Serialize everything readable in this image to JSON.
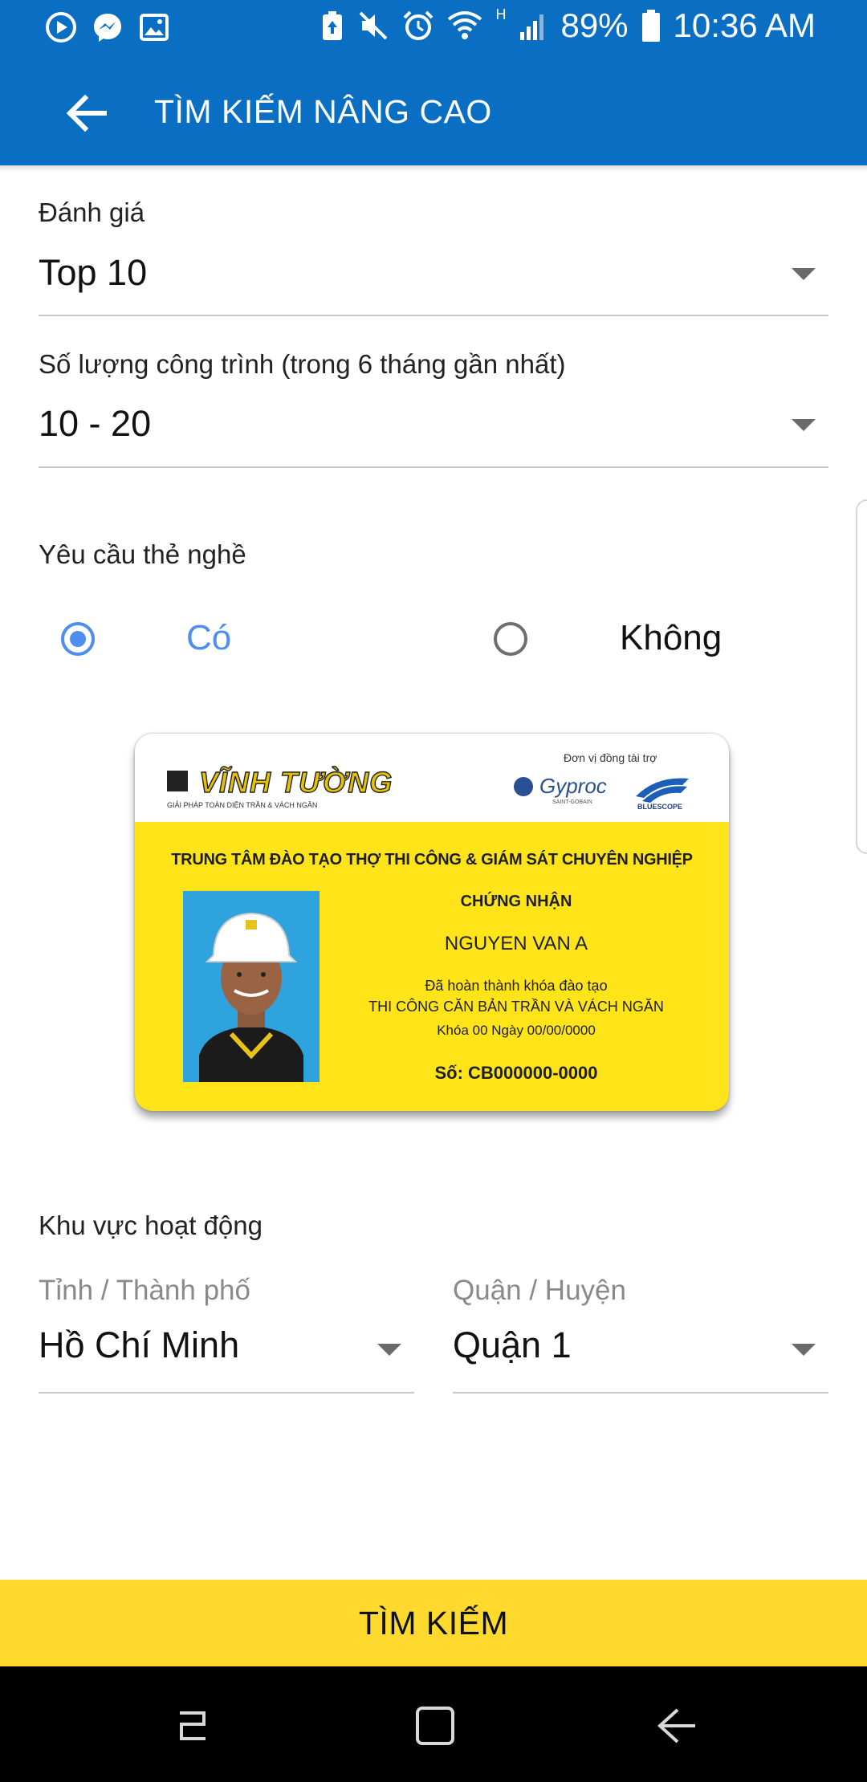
{
  "status_bar": {
    "battery": "89%",
    "time": "10:36 AM",
    "network": "H",
    "left_icons": [
      "video-app-icon",
      "messenger-icon",
      "image-icon"
    ],
    "right_icons": [
      "data-saver-icon",
      "mute-icon",
      "alarm-icon",
      "wifi-icon",
      "signal-icon",
      "battery-icon"
    ]
  },
  "app_bar": {
    "title": "TÌM KIẾM NÂNG CAO",
    "back_icon": "arrow-left-icon",
    "color": "#0a6fc2"
  },
  "rating": {
    "label": "Đánh giá",
    "value": "Top 10"
  },
  "projects": {
    "label": "Số lượng công trình (trong 6 tháng gần nhất)",
    "value": "10 - 20"
  },
  "card_requirement": {
    "label": "Yêu cầu thẻ nghề",
    "options": [
      {
        "label": "Có",
        "selected": true
      },
      {
        "label": "Không",
        "selected": false
      }
    ],
    "accent": "#4d8ef0"
  },
  "id_card": {
    "brand": "VĨNH TƯỜNG",
    "brand_sub": "GIẢI PHÁP TOÀN DIỆN TRẦN & VÁCH NGĂN",
    "sponsor_label": "Đơn vị đồng tài trợ",
    "sponsor1": "Gyproc",
    "sponsor1_sub": "SAINT-GOBAIN",
    "sponsor2": "BLUESCOPE",
    "headline": "TRUNG TÂM ĐÀO TẠO THỢ THI CÔNG & GIÁM SÁT CHUYÊN NGHIỆP",
    "cert_title": "CHỨNG NHẬN",
    "name": "NGUYEN VAN A",
    "line1": "Đã hoàn thành khóa đào tạo",
    "line2": "THI CÔNG CĂN BẢN TRẦN VÀ VÁCH NGĂN",
    "line3": "Khóa  00  Ngày  00/00/0000",
    "number": "Số: CB000000-0000",
    "card_color": "#ffe41a"
  },
  "area": {
    "label": "Khu vực hoạt động",
    "province": {
      "label": "Tỉnh / Thành phố",
      "value": "Hồ Chí Minh"
    },
    "district": {
      "label": "Quận / Huyện",
      "value": "Quận 1"
    }
  },
  "search_button": {
    "label": "TÌM KIẾM",
    "color": "#ffd92e"
  },
  "nav_bar": {
    "icons": [
      "recent-apps-icon",
      "home-icon",
      "back-icon"
    ]
  }
}
